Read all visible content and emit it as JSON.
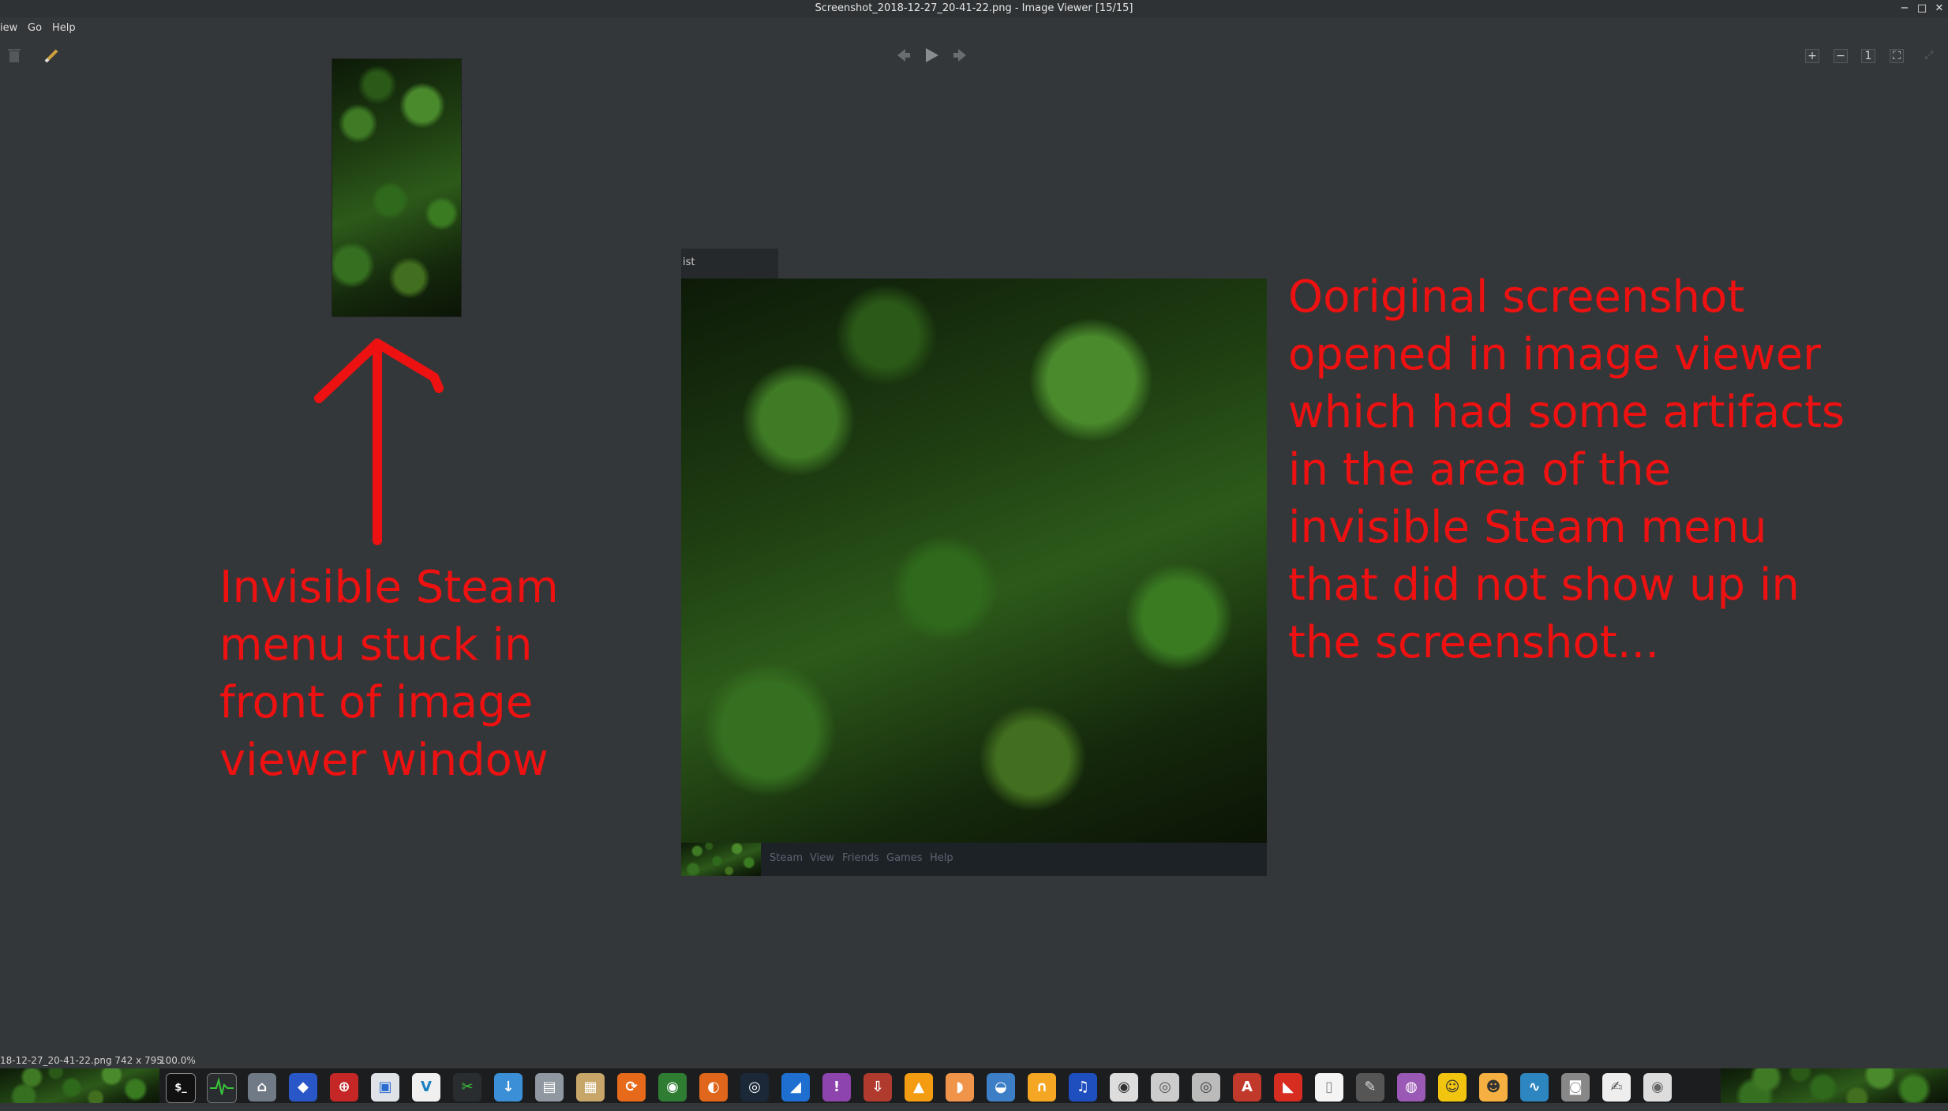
{
  "window": {
    "title": "Screenshot_2018-12-27_20-41-22.png - Image Viewer [15/15]",
    "controls": [
      "−",
      "□",
      "✕"
    ]
  },
  "menubar": {
    "items": [
      "iew",
      "Go",
      "Help"
    ]
  },
  "toolbar": {
    "delete_icon": "trash-icon",
    "edit_icon": "pencil-icon",
    "prev_icon": "arrow-left-icon",
    "play_icon": "play-icon",
    "next_icon": "arrow-right-icon",
    "zoom_in": "+",
    "zoom_out": "−",
    "actual_size": "1",
    "fit": "⛶"
  },
  "steam_overlay": {
    "tab_text": "ist",
    "menu_items": [
      "Steam",
      "View",
      "Friends",
      "Games",
      "Help"
    ]
  },
  "annotations": {
    "left": "Invisible Steam\nmenu stuck in\nfront of image\nviewer window",
    "right": "Ooriginal screenshot\nopened in image viewer\nwhich had some artifacts\nin the area of the\ninvisible Steam menu\nthat did not show up in\nthe screenshot..."
  },
  "statusbar": {
    "file_info": "18-12-27_20-41-22.png 742 x 795",
    "zoom": "100.0%"
  },
  "colors": {
    "background": "#343739",
    "annotation": "#ee1111",
    "taskbar": "#1b1d1f"
  }
}
